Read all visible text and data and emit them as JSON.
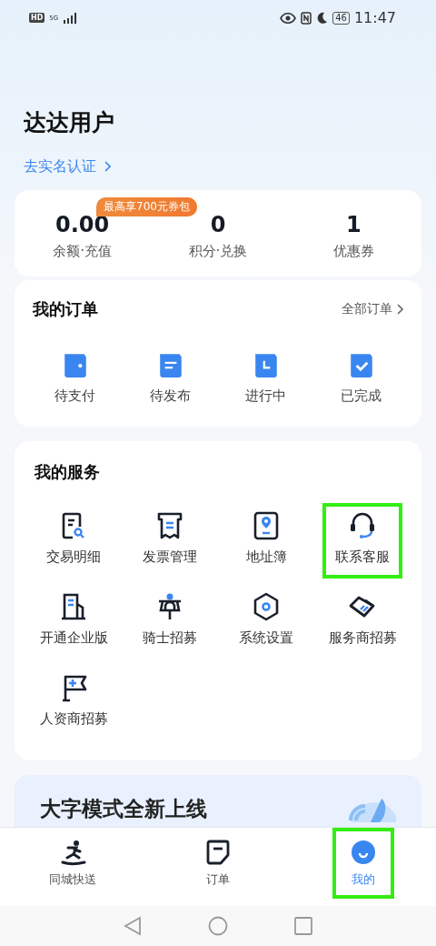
{
  "status_bar": {
    "hd": "HD",
    "network": "5G",
    "battery": "46",
    "time": "11:47"
  },
  "profile": {
    "name": "达达用户",
    "verify_link": "去实名认证"
  },
  "stats": {
    "promo_badge": "最高享700元券包",
    "items": [
      {
        "value": "0.00",
        "label": "余额·充值"
      },
      {
        "value": "0",
        "label": "积分·兑换"
      },
      {
        "value": "1",
        "label": "优惠券"
      }
    ]
  },
  "orders": {
    "title": "我的订单",
    "all_link": "全部订单",
    "items": [
      {
        "label": "待支付",
        "kind": "wallet"
      },
      {
        "label": "待发布",
        "kind": "list"
      },
      {
        "label": "进行中",
        "kind": "clock"
      },
      {
        "label": "已完成",
        "kind": "check"
      }
    ]
  },
  "services": {
    "title": "我的服务",
    "items": [
      {
        "label": "交易明细",
        "kind": "receipt",
        "highlighted": false
      },
      {
        "label": "发票管理",
        "kind": "invoice",
        "highlighted": false
      },
      {
        "label": "地址簿",
        "kind": "address",
        "highlighted": false
      },
      {
        "label": "联系客服",
        "kind": "headset",
        "highlighted": true
      },
      {
        "label": "开通企业版",
        "kind": "building",
        "highlighted": false
      },
      {
        "label": "骑士招募",
        "kind": "rider",
        "highlighted": false
      },
      {
        "label": "系统设置",
        "kind": "settings",
        "highlighted": false
      },
      {
        "label": "服务商招募",
        "kind": "handshake",
        "highlighted": false
      },
      {
        "label": "人资商招募",
        "kind": "flag",
        "highlighted": false
      }
    ]
  },
  "banner": {
    "title": "大字模式全新上线"
  },
  "tab_bar": [
    {
      "label": "同城快送",
      "kind": "runner",
      "selected": false,
      "highlighted": false
    },
    {
      "label": "订单",
      "kind": "order",
      "selected": false,
      "highlighted": false
    },
    {
      "label": "我的",
      "kind": "me",
      "selected": true,
      "highlighted": true
    }
  ]
}
